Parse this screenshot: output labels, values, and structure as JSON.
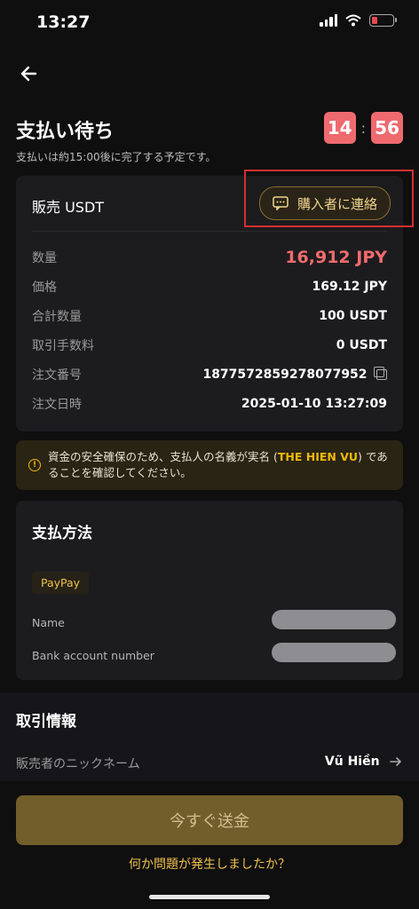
{
  "status_bar": {
    "time": "13:27"
  },
  "header": {
    "title": "支払い待ち",
    "subtitle": "支払いは約15:00後に完了する予定です。",
    "timer": {
      "minutes": "14",
      "separator": ":",
      "seconds": "56"
    }
  },
  "order": {
    "heading": "販売 USDT",
    "contact_label": "購入者に連絡",
    "rows": [
      {
        "label": "数量",
        "value": "16,912 JPY"
      },
      {
        "label": "価格",
        "value": "169.12 JPY"
      },
      {
        "label": "合計数量",
        "value": "100 USDT"
      },
      {
        "label": "取引手数料",
        "value": "0 USDT"
      },
      {
        "label": "注文番号",
        "value": "1877572859278077952"
      },
      {
        "label": "注文日時",
        "value": "2025-01-10 13:27:09"
      }
    ]
  },
  "warning": {
    "icon": "!",
    "text_before": "資金の安全確保のため、支払人の名義が実名 (",
    "highlight": "THE HIEN VU",
    "text_after": ") であることを確認してください。"
  },
  "payment": {
    "title": "支払方法",
    "method": "PayPay",
    "fields": [
      {
        "label": "Name"
      },
      {
        "label": "Bank account number"
      }
    ]
  },
  "trade_info": {
    "title": "取引情報",
    "nickname_label": "販売者のニックネーム",
    "nickname_value": "Vũ Hiền"
  },
  "actions": {
    "primary": "今すぐ送金",
    "help": "何か問題が発生しましたか？"
  },
  "colors": {
    "accent_red": "#f26b6b",
    "brand_gold": "#f0b90b",
    "timer_bg": "#ee6a6f",
    "highlight_box": "#d32f2f"
  }
}
